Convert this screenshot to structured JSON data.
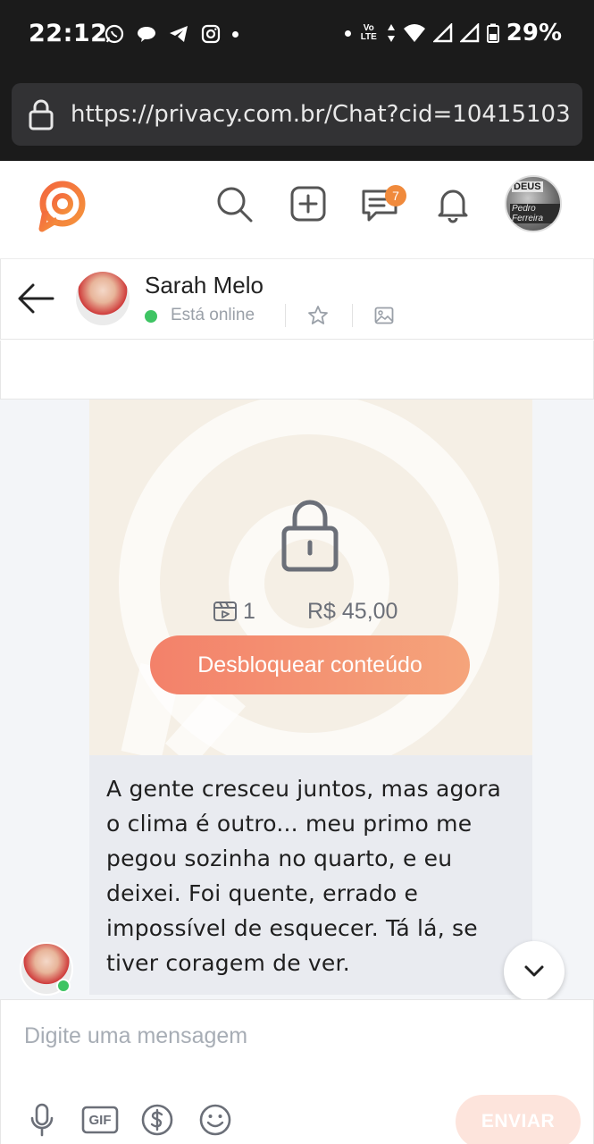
{
  "status_bar": {
    "time": "22:12",
    "network_label": "Vo LTE",
    "battery": "29%",
    "icons": [
      "whatsapp-icon",
      "chat-bubble-icon",
      "telegram-icon",
      "instagram-icon",
      "dot-icon",
      "wifi-icon",
      "signal-icon",
      "battery-icon"
    ]
  },
  "browser": {
    "url": "https://privacy.com.br/Chat?cid=10415103"
  },
  "app_header": {
    "messages_badge": "7",
    "user_avatar_text_top": "DEUS",
    "user_avatar_text_bottom": "Pedro Ferreira",
    "accent_color": "#f08a3c"
  },
  "chat_header": {
    "contact_name": "Sarah Melo",
    "status": "Está online"
  },
  "locked_message": {
    "video_count": "1",
    "price": "R$ 45,00",
    "unlock_label": "Desbloquear conteúdo"
  },
  "text_message": {
    "body": "A gente cresceu juntos, mas agora o clima é outro... meu primo me pegou sozinha no quarto, e eu deixei. Foi quente, errado e impossível de esquecer. Tá lá, se tiver coragem de ver."
  },
  "composer": {
    "placeholder": "Digite uma mensagem",
    "gif_label": "GIF",
    "send_label": "ENVIAR"
  }
}
